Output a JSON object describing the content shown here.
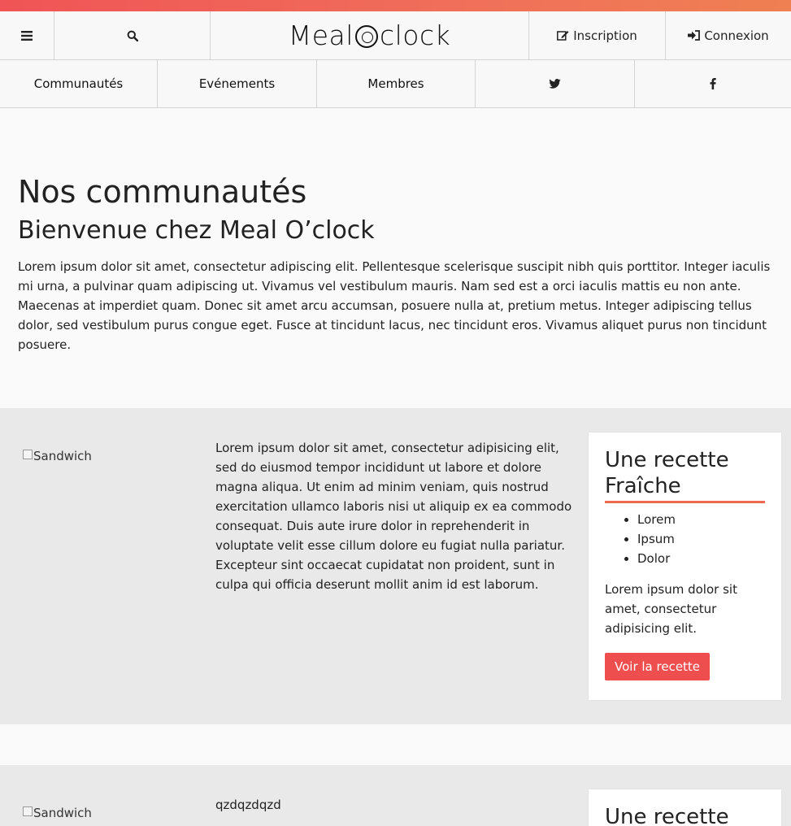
{
  "colors": {
    "brand_gradient_start": "#f05456",
    "brand_gradient_end": "#ef8052",
    "button": "#ef4e4e",
    "card_underline": "#ef6a50"
  },
  "header": {
    "logo_left": "Meal",
    "logo_right": "clock",
    "signup_label": "Inscription",
    "login_label": "Connexion",
    "icons": [
      "bars-icon",
      "search-icon",
      "edit-icon",
      "sign-in-icon"
    ]
  },
  "nav": {
    "items": [
      {
        "label": "Communautés"
      },
      {
        "label": "Evénements"
      },
      {
        "label": "Membres"
      }
    ],
    "social_icons": [
      "twitter-icon",
      "facebook-icon"
    ]
  },
  "intro": {
    "title": "Nos communautés",
    "subtitle": "Bienvenue chez Meal O’clock",
    "text": "Lorem ipsum dolor sit amet, consectetur adipiscing elit. Pellentesque scelerisque suscipit nibh quis porttitor. Integer iaculis mi urna, a pulvinar quam adipiscing ut. Vivamus vel vestibulum mauris. Nam sed est a orci iaculis mattis eu non ante. Maecenas at imperdiet quam. Donec sit amet arcu accumsan, posuere nulla at, pretium metus. Integer adipiscing tellus dolor, sed vestibulum purus congue eget. Fusce at tincidunt lacus, nec tincidunt eros. Vivamus aliquet purus non tincidunt posuere."
  },
  "communities": [
    {
      "image_alt": "Sandwich",
      "text": "Lorem ipsum dolor sit amet, consectetur adipisicing elit, sed do eiusmod tempor incididunt ut labore et dolore magna aliqua. Ut enim ad minim veniam, quis nostrud exercitation ullamco laboris nisi ut aliquip ex ea commodo consequat. Duis aute irure dolor in reprehenderit in voluptate velit esse cillum dolore eu fugiat nulla pariatur. Excepteur sint occaecat cupidatat non proident, sunt in culpa qui officia deserunt mollit anim id est laborum.",
      "card": {
        "title": "Une recette Fraîche",
        "list": [
          "Lorem",
          "Ipsum",
          "Dolor"
        ],
        "text": "Lorem ipsum dolor sit amet, consectetur adipisicing elit.",
        "button": "Voir la recette"
      }
    },
    {
      "image_alt": "Sandwich",
      "text": "qzdqzdqzd",
      "card": {
        "title": "Une recette"
      }
    }
  ]
}
